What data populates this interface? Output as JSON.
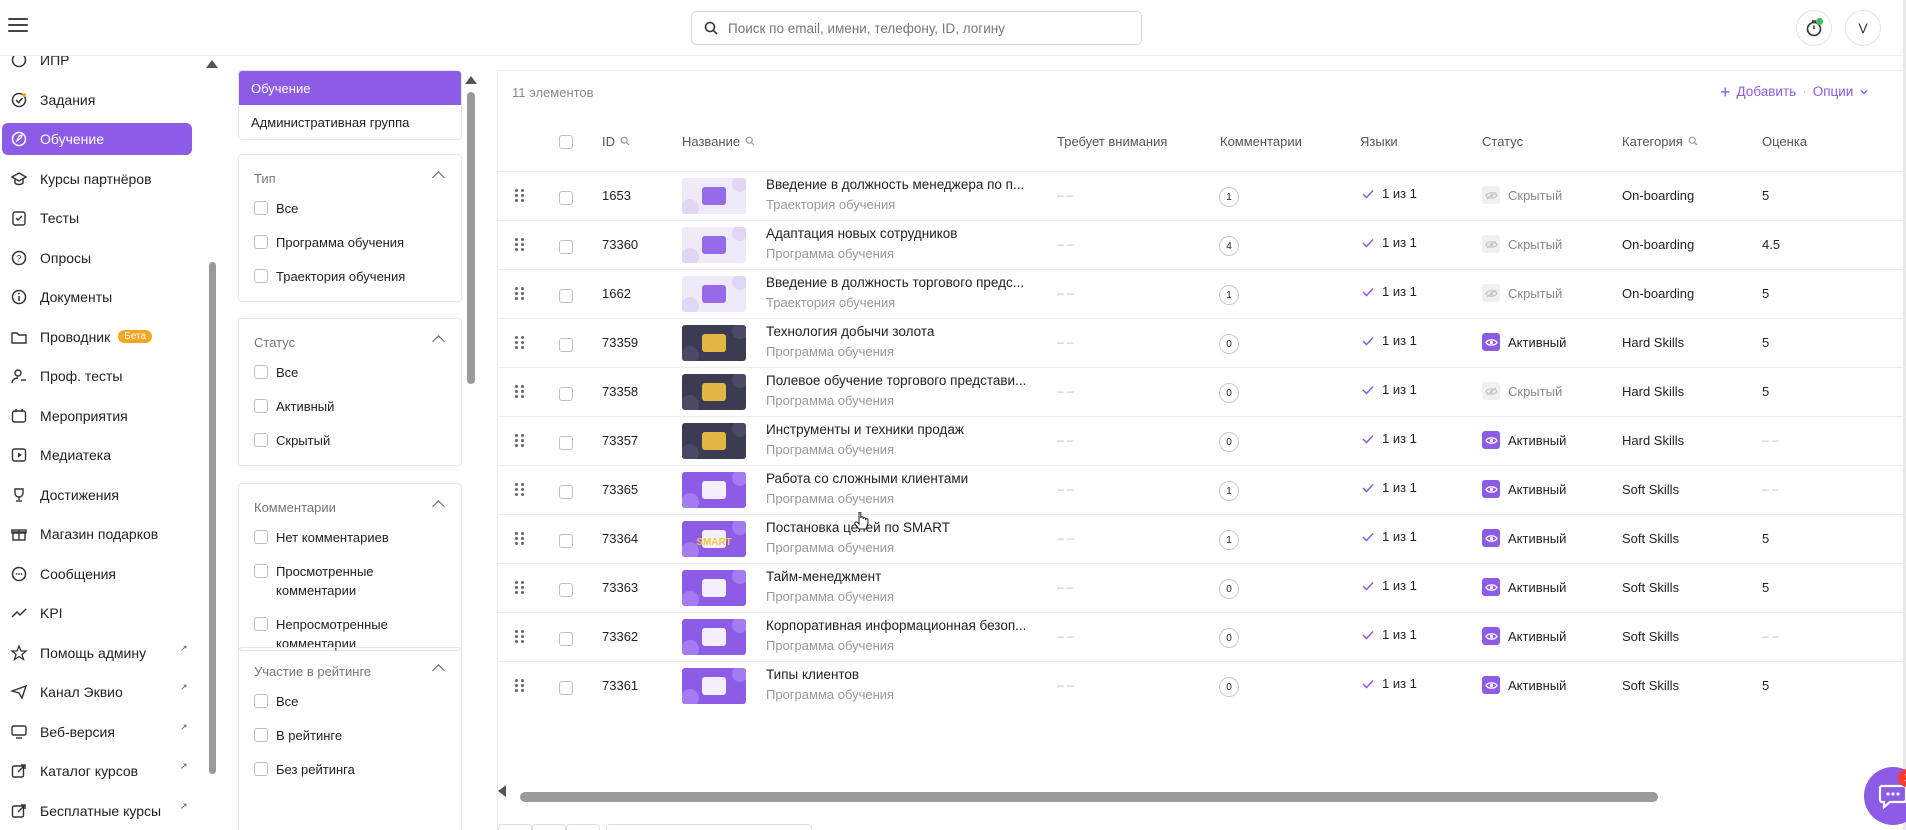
{
  "colors": {
    "accent": "#8c5ce6",
    "beta": "#f5a623",
    "notification": "#ff3b30"
  },
  "header": {
    "search_placeholder": "Поиск по email, имени, телефону, ID, логину",
    "avatar_letter": "V"
  },
  "sidebar": {
    "items": [
      {
        "label": "ИПР",
        "icon": "ipr-icon"
      },
      {
        "label": "Задания",
        "icon": "tasks-icon"
      },
      {
        "label": "Обучение",
        "icon": "learning-icon",
        "active": true
      },
      {
        "label": "Курсы партнёров",
        "icon": "partner-courses-icon"
      },
      {
        "label": "Тесты",
        "icon": "tests-icon"
      },
      {
        "label": "Опросы",
        "icon": "surveys-icon"
      },
      {
        "label": "Документы",
        "icon": "documents-icon"
      },
      {
        "label": "Проводник",
        "icon": "folder-icon",
        "badge": "Бета"
      },
      {
        "label": "Проф. тесты",
        "icon": "prof-tests-icon"
      },
      {
        "label": "Мероприятия",
        "icon": "events-icon"
      },
      {
        "label": "Медиатека",
        "icon": "media-icon"
      },
      {
        "label": "Достижения",
        "icon": "trophy-icon"
      },
      {
        "label": "Магазин подарков",
        "icon": "gift-icon"
      },
      {
        "label": "Сообщения",
        "icon": "messages-icon"
      },
      {
        "label": "KPI",
        "icon": "kpi-icon"
      },
      {
        "label": "Помощь админу",
        "icon": "star-icon",
        "external": true
      },
      {
        "label": "Канал Эквио",
        "icon": "send-icon",
        "external": true
      },
      {
        "label": "Веб-версия",
        "icon": "monitor-icon",
        "external": true
      },
      {
        "label": "Каталог курсов",
        "icon": "external-link-icon",
        "external": true
      },
      {
        "label": "Бесплатные курсы",
        "icon": "external-link-icon",
        "external": true
      }
    ]
  },
  "filters": {
    "categories": [
      {
        "label": "Обучение",
        "active": true
      },
      {
        "label": "Административная группа",
        "active": false
      }
    ],
    "groups": [
      {
        "title": "Тип",
        "options": [
          "Все",
          "Программа обучения",
          "Траектория обучения"
        ]
      },
      {
        "title": "Статус",
        "options": [
          "Все",
          "Активный",
          "Скрытый"
        ]
      },
      {
        "title": "Комментарии",
        "options": [
          "Нет комментариев",
          "Просмотренные комментарии",
          "Непросмотренные комментарии"
        ]
      },
      {
        "title": "Участие в рейтинге",
        "options": [
          "Все",
          "В рейтинге",
          "Без рейтинга"
        ]
      }
    ]
  },
  "table": {
    "count_label": "11 элементов",
    "add_label": "Добавить",
    "options_label": "Опции",
    "columns": {
      "id": "ID",
      "name": "Название",
      "attention": "Требует внимания",
      "comments": "Комментарии",
      "languages": "Языки",
      "status": "Статус",
      "category": "Категория",
      "rating": "Оценка"
    },
    "rows": [
      {
        "id": "1653",
        "title": "Введение в должность менеджера по п...",
        "type": "Траектория обучения",
        "attention": "– –",
        "comments": "1",
        "languages": "1 из 1",
        "status": "Скрытый",
        "active": false,
        "category": "On-boarding",
        "rating": "5",
        "thumb": "light"
      },
      {
        "id": "73360",
        "title": "Адаптация новых сотрудников",
        "type": "Программа обучения",
        "attention": "– –",
        "comments": "4",
        "languages": "1 из 1",
        "status": "Скрытый",
        "active": false,
        "category": "On-boarding",
        "rating": "4.5",
        "thumb": "light"
      },
      {
        "id": "1662",
        "title": "Введение в должность торгового предс...",
        "type": "Траектория обучения",
        "attention": "– –",
        "comments": "1",
        "languages": "1 из 1",
        "status": "Скрытый",
        "active": false,
        "category": "On-boarding",
        "rating": "5",
        "thumb": "light"
      },
      {
        "id": "73359",
        "title": "Технология добычи золота",
        "type": "Программа обучения",
        "attention": "– –",
        "comments": "0",
        "languages": "1 из 1",
        "status": "Активный",
        "active": true,
        "category": "Hard Skills",
        "rating": "5",
        "thumb": "dark"
      },
      {
        "id": "73358",
        "title": "Полевое обучение торгового представи...",
        "type": "Программа обучения",
        "attention": "– –",
        "comments": "0",
        "languages": "1 из 1",
        "status": "Скрытый",
        "active": false,
        "category": "Hard Skills",
        "rating": "5",
        "thumb": "dark"
      },
      {
        "id": "73357",
        "title": "Инструменты и техники продаж",
        "type": "Программа обучения",
        "attention": "– –",
        "comments": "0",
        "languages": "1 из 1",
        "status": "Активный",
        "active": true,
        "category": "Hard Skills",
        "rating": "– –",
        "thumb": "dark"
      },
      {
        "id": "73365",
        "title": "Работа со сложными клиентами",
        "type": "Программа обучения",
        "attention": "– –",
        "comments": "1",
        "languages": "1 из 1",
        "status": "Активный",
        "active": true,
        "category": "Soft Skills",
        "rating": "– –",
        "thumb": "purple"
      },
      {
        "id": "73364",
        "title": "Постановка целей по SMART",
        "type": "Программа обучения",
        "attention": "– –",
        "comments": "1",
        "languages": "1 из 1",
        "status": "Активный",
        "active": true,
        "category": "Soft Skills",
        "rating": "5",
        "thumb": "purple",
        "thumb_text": "SMART"
      },
      {
        "id": "73363",
        "title": "Тайм-менеджмент",
        "type": "Программа обучения",
        "attention": "– –",
        "comments": "0",
        "languages": "1 из 1",
        "status": "Активный",
        "active": true,
        "category": "Soft Skills",
        "rating": "5",
        "thumb": "purple"
      },
      {
        "id": "73362",
        "title": "Корпоративная информационная безоп...",
        "type": "Программа обучения",
        "attention": "– –",
        "comments": "0",
        "languages": "1 из 1",
        "status": "Активный",
        "active": true,
        "category": "Soft Skills",
        "rating": "– –",
        "thumb": "purple"
      },
      {
        "id": "73361",
        "title": "Типы клиентов",
        "type": "Программа обучения",
        "attention": "– –",
        "comments": "0",
        "languages": "1 из 1",
        "status": "Активный",
        "active": true,
        "category": "Soft Skills",
        "rating": "5",
        "thumb": "purple"
      }
    ]
  },
  "chat": {
    "notification_count": "1"
  }
}
